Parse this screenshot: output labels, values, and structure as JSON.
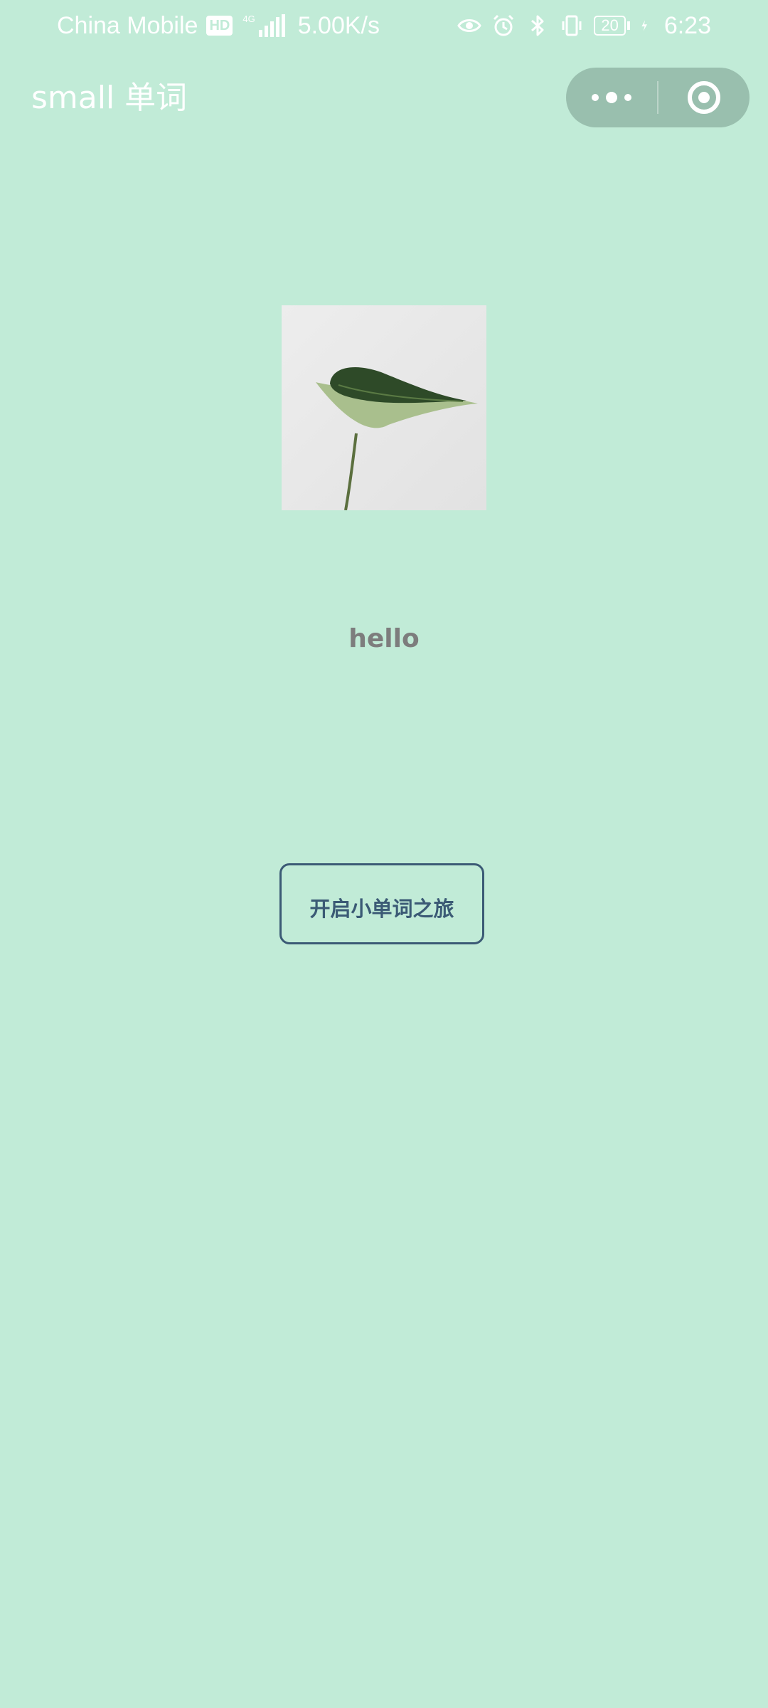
{
  "status_bar": {
    "carrier": "China Mobile",
    "hd_badge": "HD",
    "network_type": "4G",
    "net_speed": "5.00K/s",
    "battery_level": "20",
    "time": "6:23"
  },
  "nav": {
    "title": "small 单词",
    "more_icon": "more-dots-icon",
    "close_icon": "target-circle-icon"
  },
  "main": {
    "image_icon": "leaf-photo",
    "greeting": "hello",
    "start_button_label": "开启小单词之旅"
  },
  "colors": {
    "background": "#c1ebd7",
    "capsule": "#99bfae",
    "button_border": "#3b5a75",
    "greeting_text": "#7d7d7d"
  }
}
